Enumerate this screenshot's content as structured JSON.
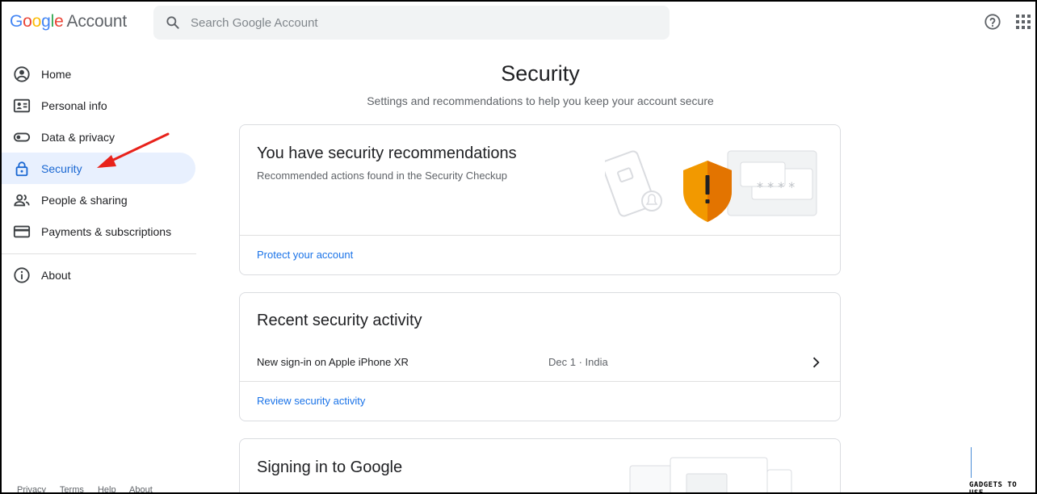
{
  "header": {
    "logo_google": "Google",
    "logo_account": "Account",
    "search_placeholder": "Search Google Account"
  },
  "sidebar": {
    "items": [
      {
        "label": "Home",
        "icon": "account-circle-icon"
      },
      {
        "label": "Personal info",
        "icon": "id-card-icon"
      },
      {
        "label": "Data & privacy",
        "icon": "toggle-icon"
      },
      {
        "label": "Security",
        "icon": "lock-icon",
        "active": true
      },
      {
        "label": "People & sharing",
        "icon": "people-icon"
      },
      {
        "label": "Payments & subscriptions",
        "icon": "credit-card-icon"
      }
    ],
    "about": {
      "label": "About",
      "icon": "info-icon"
    },
    "footer": [
      "Privacy",
      "Terms",
      "Help",
      "About"
    ]
  },
  "main": {
    "title": "Security",
    "subtitle": "Settings and recommendations to help you keep your account secure",
    "recommendations": {
      "title": "You have security recommendations",
      "description": "Recommended actions found in the Security Checkup",
      "link": "Protect your account"
    },
    "activity": {
      "title": "Recent security activity",
      "event": "New sign-in on Apple iPhone XR",
      "meta": "Dec 1 · India",
      "link": "Review security activity"
    },
    "signing_in": {
      "title": "Signing in to Google"
    }
  },
  "watermark": "GADGETS TO USE",
  "colors": {
    "accent": "#1a73e8",
    "active_bg": "#e8f0fe",
    "warning": "#f29900",
    "arrow": "#e8221b"
  }
}
